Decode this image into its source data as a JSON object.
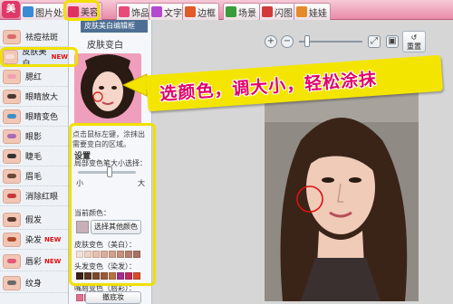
{
  "app": {
    "logo": "美"
  },
  "tabs": [
    {
      "label": "图片处理",
      "icon": "image-edit-icon",
      "color": "#3a8ad4"
    },
    {
      "label": "美容",
      "icon": "beauty-icon",
      "color": "#e03060",
      "active": true
    },
    {
      "label": "饰品",
      "icon": "heart-icon",
      "color": "#e84a7a"
    },
    {
      "label": "文字",
      "icon": "text-icon",
      "color": "#b44ad0"
    },
    {
      "label": "边框",
      "icon": "frame-icon",
      "color": "#e05a2a"
    },
    {
      "label": "场景",
      "icon": "scene-icon",
      "color": "#3b9c3b"
    },
    {
      "label": "闪图",
      "icon": "flash-icon",
      "color": "#d23a3a"
    },
    {
      "label": "娃娃",
      "icon": "doll-icon",
      "color": "#e58a2a"
    }
  ],
  "banner": {
    "text": "选颜色，调大小，轻松涂抹"
  },
  "sidebar": {
    "items": [
      {
        "label": "祛痘祛斑",
        "icon": "acne-removal-icon",
        "color": "#d96b6b"
      },
      {
        "label": "皮肤美白",
        "icon": "skin-whitening-icon",
        "color": "#f6e0d6",
        "badge": "NEW",
        "active": true
      },
      {
        "label": "腮红",
        "icon": "blush-icon",
        "color": "#f2a0b4"
      },
      {
        "label": "眼睛放大",
        "icon": "eye-enlarge-icon",
        "color": "#4a3a32"
      },
      {
        "label": "眼睛变色",
        "icon": "eye-color-icon",
        "color": "#3d8ec9"
      },
      {
        "label": "眼影",
        "icon": "eyeshadow-icon",
        "color": "#a86bb8"
      },
      {
        "label": "睫毛",
        "icon": "eyelash-icon",
        "color": "#333333"
      },
      {
        "label": "眉毛",
        "icon": "eyebrow-icon",
        "color": "#6b4a36"
      },
      {
        "label": "消除红眼",
        "icon": "red-eye-icon",
        "color": "#c43a3a"
      },
      {
        "label": "假发",
        "icon": "wig-icon",
        "color": "#5a3a2a"
      },
      {
        "label": "染发",
        "icon": "hair-dye-icon",
        "color": "#b24a2a",
        "badge": "NEW"
      },
      {
        "label": "唇彩",
        "icon": "lip-gloss-icon",
        "color": "#e05a7a",
        "badge": "NEW"
      },
      {
        "label": "纹身",
        "icon": "tattoo-icon",
        "color": "#6a6a6a"
      }
    ]
  },
  "panel": {
    "tab_label": "皮肤美白编辑框",
    "title": "皮肤变白",
    "hint": "点击鼠标左键，涂抹出需要变白的区域。",
    "options_title": "设置",
    "brush_label": "局部变色笔大小选择：",
    "size_small": "小",
    "size_large": "大",
    "brush_size_fraction": 0.55,
    "current_color_label": "当前颜色：",
    "pick_color_button": "选择其他颜色",
    "skin_label": "皮肤变色（美白）：",
    "hair_label": "头发变色（染发）：",
    "lip_label": "嘴唇变色（唇彩）：",
    "current_color": "#c9b0b8",
    "skin_swatches": [
      "#f4e2d8",
      "#f0d2c2",
      "#e8c0ae",
      "#dcae9a",
      "#d2a08c",
      "#c8907c",
      "#b88070",
      "#a87262",
      "#f2d6d6",
      "#e6c4c8",
      "#d8b2ba"
    ],
    "hair_swatches": [
      "#3a2418",
      "#5a3422",
      "#7a4a2e",
      "#9a5a36",
      "#b8743e",
      "#a0308a",
      "#c02a5a",
      "#d84a2a",
      "#2a3a8a",
      "#5a2a8a",
      "#1a1a1a"
    ],
    "lip_swatches": [
      "#e07090",
      "#d0506e",
      "#c03a5a",
      "#a82a4a",
      "#e88aa8",
      "#f0a8c0",
      "#c84aa0",
      "#a03a8a",
      "#e87a5a",
      "#d85a3a",
      "#b83a3a"
    ],
    "bottom_button": "撤底妆"
  },
  "canvas": {
    "reset_label": "重置",
    "zoom_fraction": 0.1
  }
}
